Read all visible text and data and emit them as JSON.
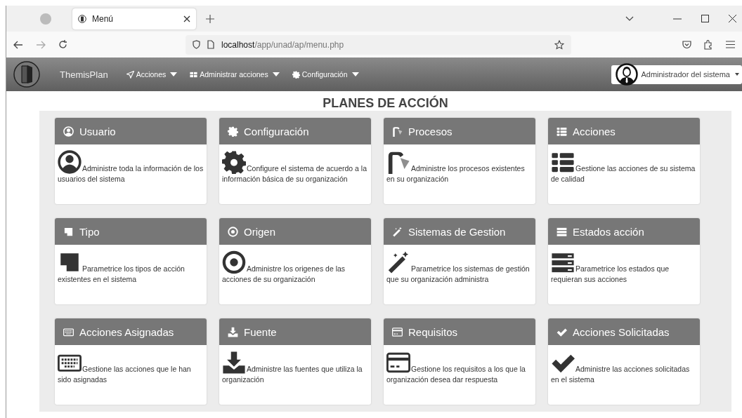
{
  "browser": {
    "tab": {
      "title": "Menú",
      "selected": true
    },
    "url_host": "localhost",
    "url_path": "/app/unad/ap/menu.php"
  },
  "navbar": {
    "brand": "ThemisPlan",
    "menus": [
      {
        "label": "Acciones",
        "kind": "send"
      },
      {
        "label": "Administrar acciones",
        "kind": "grid"
      },
      {
        "label": "Configuración",
        "kind": "gear"
      }
    ],
    "user": "Administrador del sistema"
  },
  "page_title": "PLANES DE ACCIÓN",
  "cards": [
    {
      "title": "Usuario",
      "kind": "user",
      "text": "Administre toda la información de los usuarios del sistema"
    },
    {
      "title": "Configuración",
      "kind": "gear",
      "text": "Configure el sistema de acuerdo a la información básica de su organización"
    },
    {
      "title": "Procesos",
      "kind": "shower",
      "text": "Administre los procesos existentes en su organización"
    },
    {
      "title": "Acciones",
      "kind": "list",
      "text": "Gestione las acciones de su sistema de calidad"
    },
    {
      "title": "Tipo",
      "kind": "tag",
      "text": "Parametrice los tipos de acción existentes en el sistema"
    },
    {
      "title": "Origen",
      "kind": "target",
      "text": "Administre los origenes de las acciones de su organización"
    },
    {
      "title": "Sistemas de Gestion",
      "kind": "wand",
      "text": "Parametrice los sistemas de gestión que su organización administra"
    },
    {
      "title": "Estados acción",
      "kind": "server",
      "text": "Parametrice los estados que requieran sus acciones"
    },
    {
      "title": "Acciones Asignadas",
      "kind": "keyboard",
      "text": "Gestione las acciones que le han sido asignadas"
    },
    {
      "title": "Fuente",
      "kind": "download",
      "text": "Administre las fuentes que utiliza la organización"
    },
    {
      "title": "Requisitos",
      "kind": "card",
      "text": "Gestione los requisitos a los que la organización desea dar respuesta"
    },
    {
      "title": "Acciones Solicitadas",
      "kind": "check",
      "text": "Administre las acciones solicitadas en el sistema"
    }
  ]
}
